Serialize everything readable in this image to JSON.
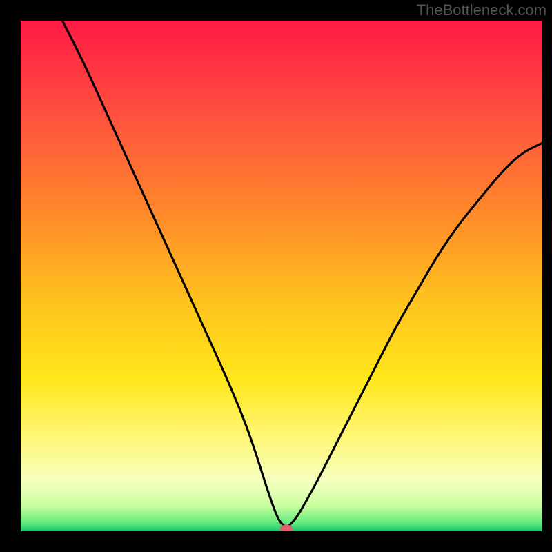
{
  "watermark": "TheBottleneck.com",
  "chart_data": {
    "type": "line",
    "title": "",
    "xlabel": "",
    "ylabel": "",
    "xlim": [
      0,
      100
    ],
    "ylim": [
      0,
      100
    ],
    "curve": {
      "comment": "V-shaped black curve descending from top-left, reaching a minimum near x≈50 at y≈0, then rising to upper-right. Values are approximate normalized percentages read from the plot.",
      "x": [
        8,
        12,
        16,
        20,
        24,
        28,
        32,
        36,
        40,
        44,
        48,
        50,
        52,
        56,
        60,
        64,
        68,
        72,
        76,
        80,
        84,
        88,
        92,
        96,
        100
      ],
      "y": [
        100,
        92,
        83,
        74,
        65,
        56,
        47,
        38,
        29,
        19,
        6,
        1,
        1,
        8,
        16,
        24,
        32,
        40,
        47,
        54,
        60,
        65,
        70,
        74,
        76
      ]
    },
    "marker": {
      "comment": "Small pink/red oval marker at the curve minimum",
      "x": 51,
      "y": 0.5,
      "color": "#e06070"
    },
    "background_gradient": {
      "comment": "Vertical gradient fill of plot area from red at top through orange, yellow, pale yellow, to green at the very bottom",
      "stops": [
        {
          "pos": 0.0,
          "color": "#ff1a44"
        },
        {
          "pos": 0.18,
          "color": "#ff4f3f"
        },
        {
          "pos": 0.38,
          "color": "#ff8a2a"
        },
        {
          "pos": 0.55,
          "color": "#ffc21e"
        },
        {
          "pos": 0.7,
          "color": "#ffe71a"
        },
        {
          "pos": 0.82,
          "color": "#fff77a"
        },
        {
          "pos": 0.9,
          "color": "#f6ffbf"
        },
        {
          "pos": 0.95,
          "color": "#c9ff9f"
        },
        {
          "pos": 0.985,
          "color": "#5fe87a"
        },
        {
          "pos": 1.0,
          "color": "#17c46a"
        }
      ]
    }
  }
}
